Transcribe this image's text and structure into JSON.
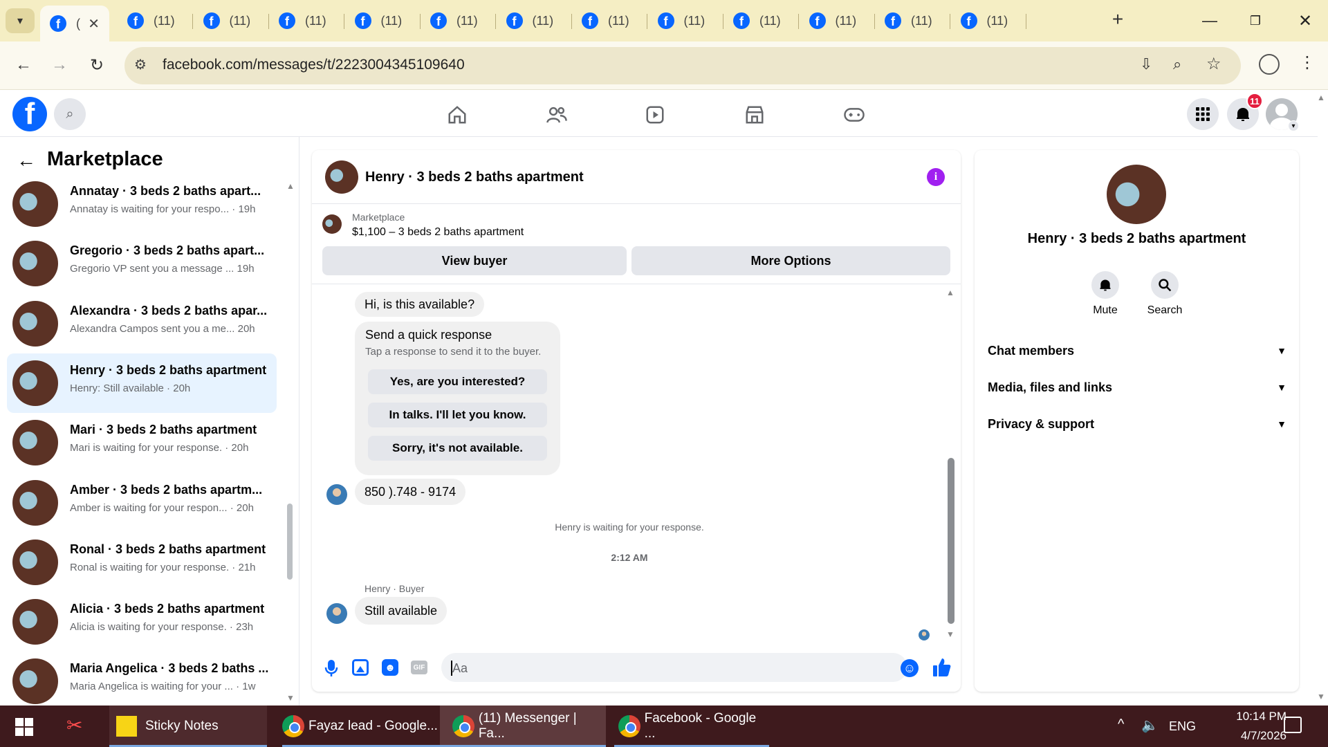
{
  "browser": {
    "active_tab_label": "(",
    "tab_label": "(11)",
    "tab_count": 13,
    "url": "facebook.com/messages/t/2223004345109640"
  },
  "header": {
    "notification_count": "11"
  },
  "sidebar": {
    "title": "Marketplace",
    "conversations": [
      {
        "title": "Annatay · 3 beds 2 baths apart...",
        "snippet": "Annatay is waiting for your respo... · 19h"
      },
      {
        "title": "Gregorio · 3 beds 2 baths apart...",
        "snippet": "Gregorio VP sent you a message ...  19h"
      },
      {
        "title": "Alexandra · 3 beds 2 baths apar...",
        "snippet": "Alexandra Campos sent you a me...  20h"
      },
      {
        "title": "Henry · 3 beds 2 baths apartment",
        "snippet": "Henry: Still available · 20h"
      },
      {
        "title": "Mari · 3 beds 2 baths apartment",
        "snippet": "Mari is waiting for your response. · 20h"
      },
      {
        "title": "Amber · 3 beds 2 baths apartm...",
        "snippet": "Amber is waiting for your respon... · 20h"
      },
      {
        "title": "Ronal · 3 beds 2 baths apartment",
        "snippet": "Ronal is waiting for your response. · 21h"
      },
      {
        "title": "Alicia · 3 beds 2 baths apartment",
        "snippet": "Alicia is waiting for your response. · 23h"
      },
      {
        "title": "Maria Angelica · 3 beds 2 baths ...",
        "snippet": "Maria Angelica is waiting for your ... · 1w"
      }
    ]
  },
  "chat": {
    "title": "Henry · 3 beds 2 baths apartment",
    "listing_label": "Marketplace",
    "listing_title": "$1,100 – 3 beds 2 baths apartment",
    "view_buyer": "View buyer",
    "more_options": "More Options",
    "msg1": "Hi, is this available?",
    "quick_title": "Send a quick response",
    "quick_sub": "Tap a response to send it to the buyer.",
    "quick_responses": [
      "Yes, are you interested?",
      "In talks. I'll let you know.",
      "Sorry, it's not available."
    ],
    "msg2": "850 ).748 - 9174",
    "waiting": "Henry is waiting for your response.",
    "time": "2:12 AM",
    "sender": "Henry · Buyer",
    "msg3": "Still available",
    "composer_placeholder": "Aa"
  },
  "details": {
    "name": "Henry · 3 beds 2 baths apartment",
    "mute": "Mute",
    "search": "Search",
    "sections": [
      "Chat members",
      "Media, files and links",
      "Privacy & support"
    ]
  },
  "taskbar": {
    "sticky": "Sticky Notes",
    "app1": "Fayaz lead - Google...",
    "app2": "(11) Messenger | Fa...",
    "app3": "Facebook - Google ...",
    "lang": "ENG",
    "time": "10:14 PM",
    "date": "4/7/2026"
  }
}
